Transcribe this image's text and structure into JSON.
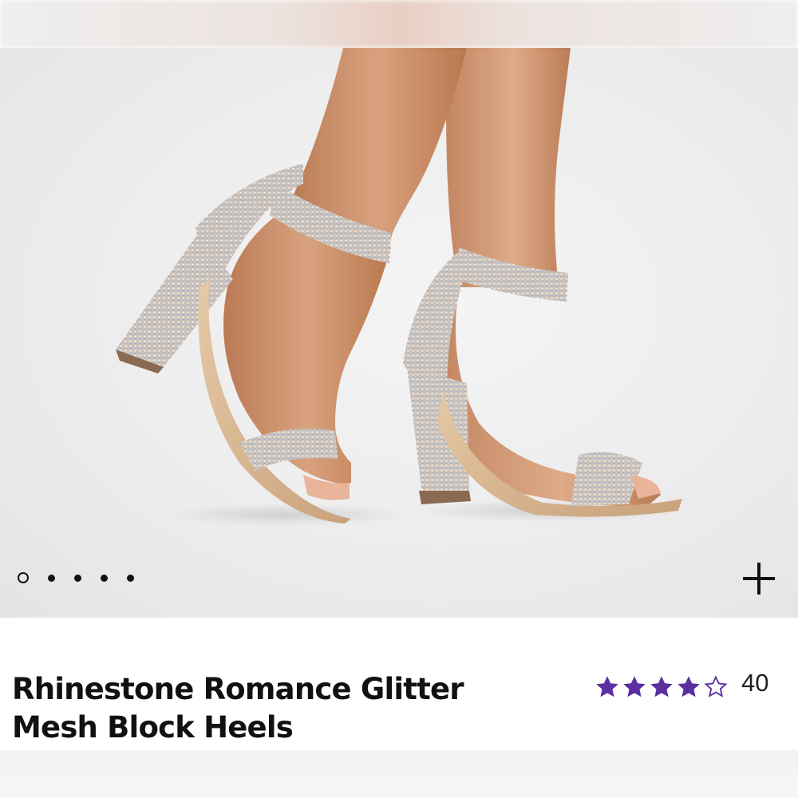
{
  "product": {
    "title": "Rhinestone Romance Glitter Mesh Block Heels",
    "image_icon": "product-photo-rhinestone-heels",
    "rating": {
      "stars_filled": 4,
      "stars_total": 5,
      "review_count": "40",
      "star_color": "#5b2fa0"
    }
  },
  "carousel": {
    "total_slides": 5,
    "active_index": 0
  },
  "zoom": {
    "icon": "plus-icon"
  }
}
